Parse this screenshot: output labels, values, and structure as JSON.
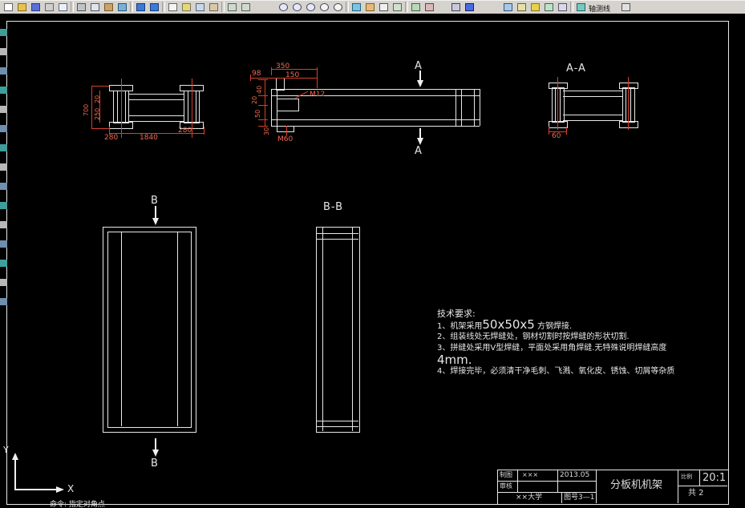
{
  "toolbar": {
    "axis_label": "轴测线"
  },
  "views": {
    "front": {
      "h": "700",
      "seg_a": "20",
      "seg_b": "250",
      "length": "1840",
      "foot_left": "280",
      "foot_right": "280"
    },
    "side": {
      "w98": "98",
      "w350": "350",
      "w150": "150",
      "h40": "40",
      "h20": "20",
      "h50": "50",
      "h30": "30",
      "m12": "M12",
      "m60": "M60",
      "a_mark": "A"
    },
    "section_aa": {
      "label": "A-A",
      "d60": "60"
    },
    "top": {
      "b_mark": "B"
    },
    "section_bb": {
      "label": "B-B"
    }
  },
  "tech": {
    "title": "技术要求:",
    "l1a": "1、机架采用",
    "l1b": "50x50x5",
    "l1c": " 方钢焊接.",
    "l2": "2、组装线处无焊缝处，钢材切割时按焊缝的形状切割.",
    "l3": "3、拼缝处采用V型焊缝，平面处采用角焊缝.无特殊说明焊缝高度",
    "l3b": "4mm.",
    "l4": "4、焊接完毕，必须清干净毛刺、飞溅、氧化皮、锈蚀、切屑等杂质"
  },
  "title_block": {
    "draw_label": "制图",
    "draw_name": "×××",
    "date": "2013.05",
    "check_label": "审核",
    "title": "分板机机架",
    "scale_label": "比例",
    "scale_value": "20:1",
    "sheet_note": "共 2",
    "org": "××大学",
    "drawing_no": "图号3—1"
  },
  "ucs": {
    "x": "X",
    "y": "Y"
  },
  "command_line": {
    "prompt": "命令: 指定对角点"
  }
}
